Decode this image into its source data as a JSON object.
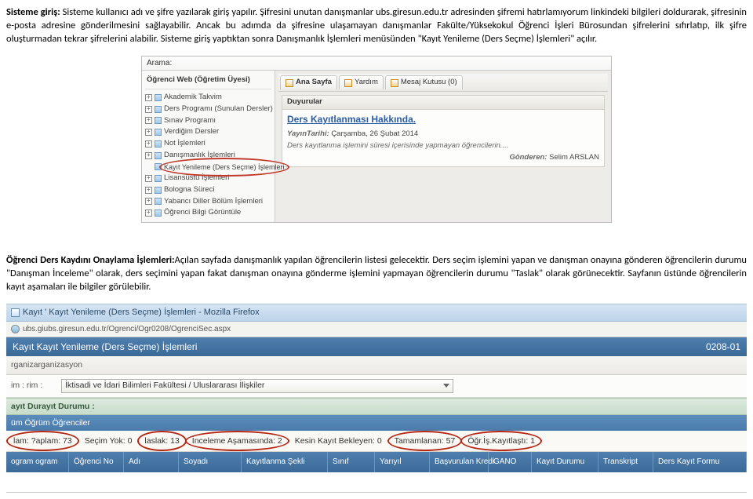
{
  "paragraph1_prefix_bold": "Sisteme giriş:",
  "paragraph1_rest": " Sisteme kullanıcı adı ve şifre yazılarak giriş yapılır. Şifresini unutan danışmanlar ubs.giresun.edu.tr adresinden şifremi  hatırlamıyorum linkindeki bilgileri doldurarak, şifresinin e-posta adresine gönderilmesini sağlayabilir. Ancak bu adımda da şifresine  ulaşamayan danışmanlar Fakülte/Yüksekokul Öğrenci İşleri Bürosundan şifrelerini sıfırlatıp, ilk şifre oluşturmadan tekrar şifrelerini alabilir. Sisteme giriş yaptıktan sonra Danışmanlık İşlemleri menüsünden \"Kayıt Yenileme (Ders Seçme) İşlemleri\" açılır.",
  "shot1": {
    "search_label": "Arama:",
    "tree_title": "Öğrenci Web (Öğretim Üyesi)",
    "nodes": [
      "Akademik Takvim",
      "Ders Programı (Sunulan Dersler)",
      "Sınav Programı",
      "Verdiğim Dersler",
      "Not İşlemleri",
      "Danışmanlık İşlemleri"
    ],
    "highlighted_sub": "Kayıt Yenileme (Ders Seçme) İşlemleri",
    "nodes_after": [
      "Lisansüstü İşlemleri",
      "Bologna Süreci",
      "Yabancı Diller Bölüm İşlemleri",
      "Öğrenci Bilgi Görüntüle"
    ],
    "tabs": [
      "Ana Sayfa",
      "Yardım",
      "Mesaj Kutusu (0)"
    ],
    "panel_duyurular": "Duyurular",
    "ann_title": "Ders Kayıtlanması Hakkında.",
    "ann_date_label": "YayınTarihi:",
    "ann_date_value": "Çarşamba, 26 Şubat 2014",
    "ann_body_italic": "Ders kayıtlanma işlemini süresi içerisinde yapmayan öğrencilerin....",
    "ann_sender_label": "Gönderen:",
    "ann_sender_value": "Selim ARSLAN"
  },
  "paragraph2_prefix_bold": "Öğrenci Ders Kaydını Onaylama İşlemleri:",
  "paragraph2_rest": "Açılan sayfada danışmanlık yapılan öğrencilerin listesi gelecektir. Ders seçim işlemini yapan ve danışman onayına gönderen öğrencilerin durumu \"Danışman İnceleme\" olarak, ders seçimini yapan fakat danışman onayına gönderme işlemini yapmayan öğrencilerin durumu \"Taslak\" olarak görünecektir.   Sayfanın üstünde öğrencilerin kayıt aşamaları ile bilgiler görülebilir.",
  "shot2": {
    "window_title": "Kayıt ' Kayıt Yenileme (Ders Seçme) İşlemleri - Mozilla Firefox",
    "url": "ubs.giubs.giresun.edu.tr/Ogrenci/Ogr0208/OgrenciSec.aspx",
    "bluebar_left": "Kayıt Kayıt Yenileme (Ders Seçme) İşlemleri",
    "bluebar_right": "0208-01",
    "org_label": "rganizarganizasyon",
    "birim_label": "im :  rim :",
    "birim_value": "İktisadi ve İdari Bilimleri Fakültesi / Uluslararası İlişkiler",
    "group1": "ayıt Durayıt Durumu :",
    "bluethin": "üm Öğrüm Öğrenciler",
    "stats": {
      "toplam": "lam: ?aplam: 73",
      "secimyok": "Seçim Yok: 0",
      "taslak": "laslak: 13",
      "inceleme": "İnceleme Aşamasında: 2",
      "kesin": "Kesin Kayıt Bekleyen: 0",
      "tamamlanan": "Tamamlanan: 57",
      "iskayit": "Öğr.İş.Kayıtlaştı: 1"
    },
    "cols": [
      "ogram ogram",
      "Öğrenci No",
      "Adı",
      "Soyadı",
      "Kayıtlanma Şekli",
      "Sınıf",
      "Yarıyıl",
      "Başvurulan Kredi",
      "GANO",
      "Kayıt Durumu",
      "Transkript",
      "Ders Kayıt Formu"
    ]
  }
}
